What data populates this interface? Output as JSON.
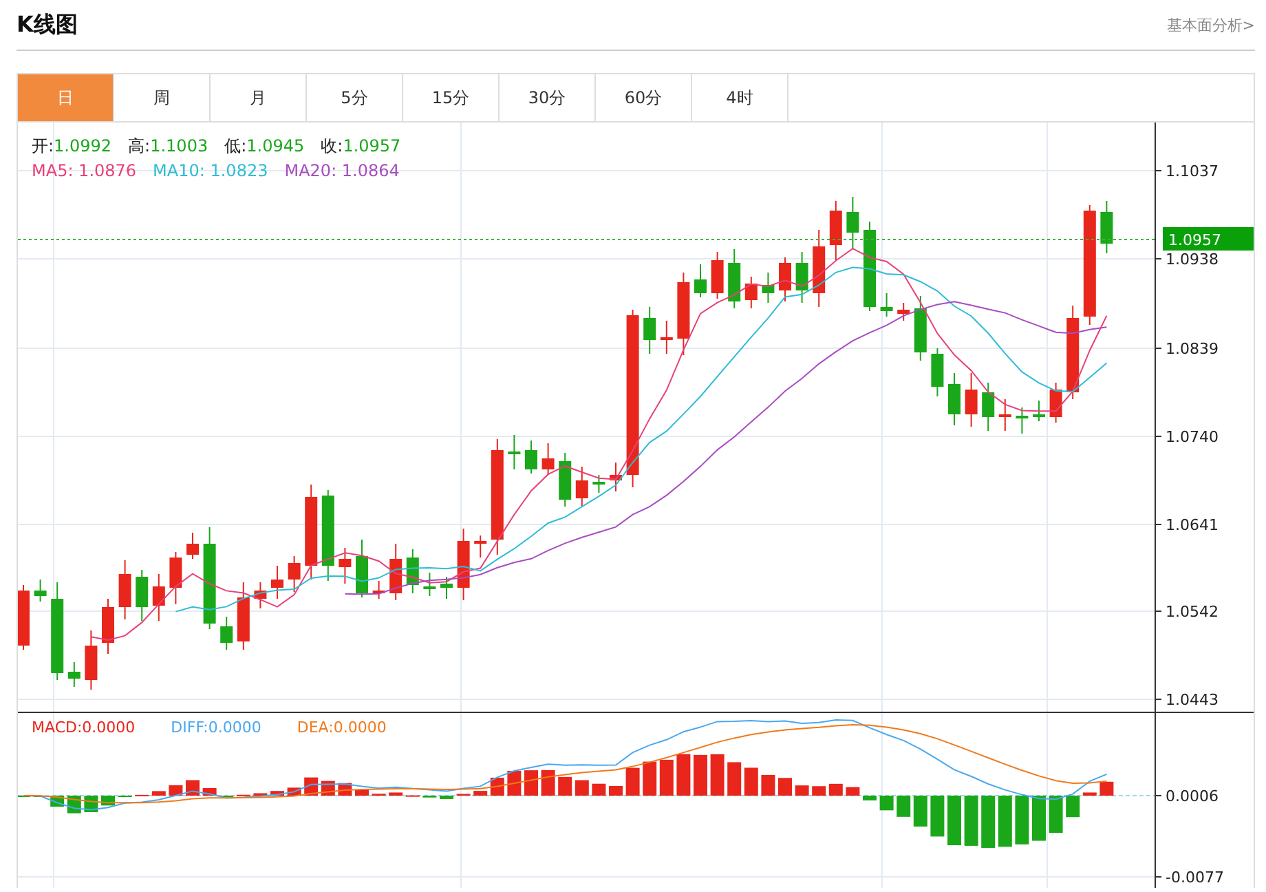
{
  "header": {
    "title": "K线图",
    "link": "基本面分析>"
  },
  "tabs": [
    {
      "label": "日",
      "selected": true
    },
    {
      "label": "周",
      "selected": false
    },
    {
      "label": "月",
      "selected": false
    },
    {
      "label": "5分",
      "selected": false
    },
    {
      "label": "15分",
      "selected": false
    },
    {
      "label": "30分",
      "selected": false
    },
    {
      "label": "60分",
      "selected": false
    },
    {
      "label": "4时",
      "selected": false
    }
  ],
  "ohlc": [
    {
      "label": "开:",
      "value": "1.0992"
    },
    {
      "label": "高:",
      "value": "1.1003"
    },
    {
      "label": "低:",
      "value": "1.0945"
    },
    {
      "label": "收:",
      "value": "1.0957"
    }
  ],
  "ma_legend": [
    {
      "label": "MA5:",
      "value": "1.0876",
      "color": "#e8417a"
    },
    {
      "label": "MA10:",
      "value": "1.0823",
      "color": "#2fbcd6"
    },
    {
      "label": "MA20:",
      "value": "1.0864",
      "color": "#a84cc0"
    }
  ],
  "price_axis": {
    "ticks": [
      "1.1037",
      "1.0938",
      "1.0839",
      "1.0740",
      "1.0641",
      "1.0542",
      "1.0443"
    ],
    "current_price": "1.0957"
  },
  "macd_legend": [
    {
      "label": "MACD:",
      "value": "0.0000",
      "color": "#e8261c"
    },
    {
      "label": "DIFF:",
      "value": "0.0000",
      "color": "#4aa8f0"
    },
    {
      "label": "DEA:",
      "value": "0.0000",
      "color": "#f07a1c"
    }
  ],
  "macd_axis": {
    "ticks": [
      "0.0006",
      "-0.0077"
    ]
  }
}
